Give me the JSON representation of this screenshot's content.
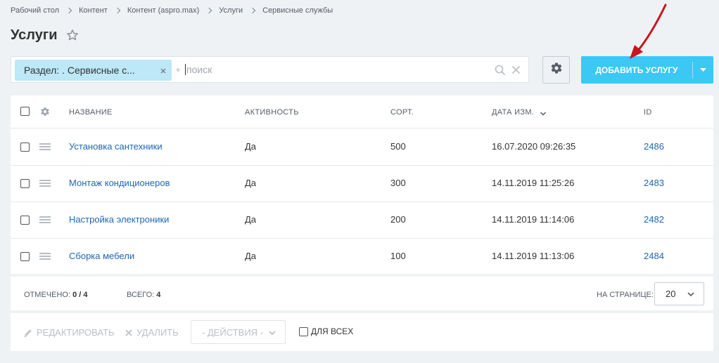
{
  "breadcrumb": [
    "Рабочий стол",
    "Контент",
    "Контент (aspro.max)",
    "Услуги",
    "Сервисные службы"
  ],
  "title": "Услуги",
  "filter": {
    "chip_label": "Раздел: . Сервисные с...",
    "plus": "+",
    "placeholder": "поиск"
  },
  "add_button_label": "ДОБАВИТЬ УСЛУГУ",
  "columns": {
    "name": "НАЗВАНИЕ",
    "active": "АКТИВНОСТЬ",
    "sort": "СОРТ.",
    "date": "ДАТА ИЗМ.",
    "id": "ID"
  },
  "rows": [
    {
      "name": "Установка сантехники",
      "active": "Да",
      "sort": "500",
      "date": "16.07.2020 09:26:35",
      "id": "2486"
    },
    {
      "name": "Монтаж кондиционеров",
      "active": "Да",
      "sort": "300",
      "date": "14.11.2019 11:25:26",
      "id": "2483"
    },
    {
      "name": "Настройка электроники",
      "active": "Да",
      "sort": "200",
      "date": "14.11.2019 11:14:06",
      "id": "2482"
    },
    {
      "name": "Сборка мебели",
      "active": "Да",
      "sort": "100",
      "date": "14.11.2019 11:13:06",
      "id": "2484"
    }
  ],
  "footer": {
    "selected_label": "ОТМЕЧЕНО:",
    "selected_value": "0 / 4",
    "total_label": "ВСЕГО:",
    "total_value": "4",
    "per_page_label": "НА СТРАНИЦЕ:",
    "per_page_value": "20"
  },
  "actions": {
    "edit": "РЕДАКТИРОВАТЬ",
    "delete": "УДАЛИТЬ",
    "actions_select": "- ДЕЙСТВИЯ -",
    "for_all": "ДЛЯ ВСЕХ"
  },
  "colors": {
    "accent": "#3bc8f5",
    "chip": "#bce8f7",
    "link": "#2067b0",
    "annotation_arrow": "#c8161d"
  }
}
